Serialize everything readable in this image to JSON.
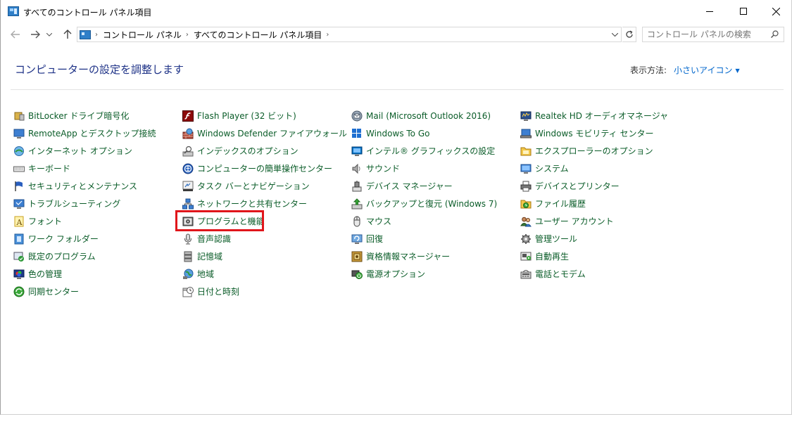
{
  "window": {
    "title": "すべてのコントロール パネル項目"
  },
  "nav": {
    "breadcrumb": [
      "コントロール パネル",
      "すべてのコントロール パネル項目"
    ],
    "search_placeholder": "コントロール パネルの検索"
  },
  "header": {
    "title": "コンピューターの設定を調整します",
    "view_by_label": "表示方法:",
    "view_by_value": "小さいアイコン"
  },
  "columns": [
    [
      {
        "label": "BitLocker ドライブ暗号化",
        "icon": "bitlocker-icon"
      },
      {
        "label": "RemoteApp とデスクトップ接続",
        "icon": "remoteapp-icon"
      },
      {
        "label": "インターネット オプション",
        "icon": "internet-options-icon"
      },
      {
        "label": "キーボード",
        "icon": "keyboard-icon"
      },
      {
        "label": "セキュリティとメンテナンス",
        "icon": "flag-icon"
      },
      {
        "label": "トラブルシューティング",
        "icon": "troubleshoot-icon"
      },
      {
        "label": "フォント",
        "icon": "font-icon"
      },
      {
        "label": "ワーク フォルダー",
        "icon": "work-folders-icon"
      },
      {
        "label": "既定のプログラム",
        "icon": "default-programs-icon"
      },
      {
        "label": "色の管理",
        "icon": "color-management-icon"
      },
      {
        "label": "同期センター",
        "icon": "sync-center-icon"
      }
    ],
    [
      {
        "label": "Flash Player (32 ビット)",
        "icon": "flash-icon"
      },
      {
        "label": "Windows Defender ファイアウォール",
        "icon": "firewall-icon"
      },
      {
        "label": "インデックスのオプション",
        "icon": "indexing-icon"
      },
      {
        "label": "コンピューターの簡単操作センター",
        "icon": "ease-of-access-icon"
      },
      {
        "label": "タスク バーとナビゲーション",
        "icon": "taskbar-icon"
      },
      {
        "label": "ネットワークと共有センター",
        "icon": "network-icon"
      },
      {
        "label": "プログラムと機能",
        "icon": "programs-features-icon"
      },
      {
        "label": "音声認識",
        "icon": "microphone-icon"
      },
      {
        "label": "記憶域",
        "icon": "storage-icon"
      },
      {
        "label": "地域",
        "icon": "region-icon"
      },
      {
        "label": "日付と時刻",
        "icon": "date-time-icon"
      }
    ],
    [
      {
        "label": "Mail (Microsoft Outlook 2016)",
        "icon": "mail-icon"
      },
      {
        "label": "Windows To Go",
        "icon": "windows-to-go-icon"
      },
      {
        "label": "インテル® グラフィックスの設定",
        "icon": "intel-graphics-icon"
      },
      {
        "label": "サウンド",
        "icon": "speaker-icon"
      },
      {
        "label": "デバイス マネージャー",
        "icon": "device-manager-icon"
      },
      {
        "label": "バックアップと復元 (Windows 7)",
        "icon": "backup-icon"
      },
      {
        "label": "マウス",
        "icon": "mouse-icon"
      },
      {
        "label": "回復",
        "icon": "recovery-icon"
      },
      {
        "label": "資格情報マネージャー",
        "icon": "credential-icon"
      },
      {
        "label": "電源オプション",
        "icon": "power-icon"
      }
    ],
    [
      {
        "label": "Realtek HD オーディオマネージャ",
        "icon": "realtek-icon"
      },
      {
        "label": "Windows モビリティ センター",
        "icon": "mobility-icon"
      },
      {
        "label": "エクスプローラーのオプション",
        "icon": "explorer-options-icon"
      },
      {
        "label": "システム",
        "icon": "system-icon"
      },
      {
        "label": "デバイスとプリンター",
        "icon": "printer-icon"
      },
      {
        "label": "ファイル履歴",
        "icon": "file-history-icon"
      },
      {
        "label": "ユーザー アカウント",
        "icon": "user-accounts-icon"
      },
      {
        "label": "管理ツール",
        "icon": "admin-tools-icon"
      },
      {
        "label": "自動再生",
        "icon": "autoplay-icon"
      },
      {
        "label": "電話とモデム",
        "icon": "phone-modem-icon"
      }
    ]
  ],
  "colors": {
    "header_title": "#1e3287",
    "item_text": "#0a5c28",
    "link": "#0066cc",
    "highlight_box": "#e0161b"
  }
}
